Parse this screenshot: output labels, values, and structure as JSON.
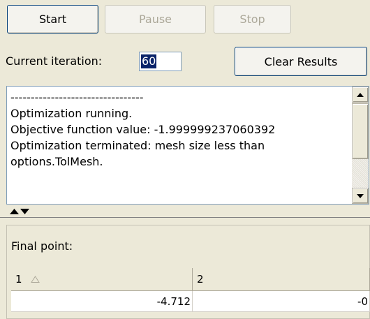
{
  "toolbar": {
    "start_label": "Start",
    "pause_label": "Pause",
    "stop_label": "Stop",
    "clear_results_label": "Clear Results"
  },
  "iteration": {
    "label": "Current iteration:",
    "value": "60"
  },
  "output": {
    "lines": [
      "---------------------------------",
      "Optimization running.",
      "Objective function value: -1.999999237060392",
      "Optimization terminated: mesh size less than",
      "options.TolMesh."
    ]
  },
  "results": {
    "label": "Final point:",
    "columns": [
      "1",
      "2"
    ],
    "values": [
      "-4.712",
      "-0"
    ]
  },
  "icons": {
    "sort": "sort-ascending-icon",
    "split_up": "arrow-up-icon",
    "split_down": "arrow-down-icon",
    "scroll_up": "scroll-up-icon",
    "scroll_down": "scroll-down-icon"
  },
  "colors": {
    "selection": "#0a246a",
    "background": "#ece9d8"
  }
}
